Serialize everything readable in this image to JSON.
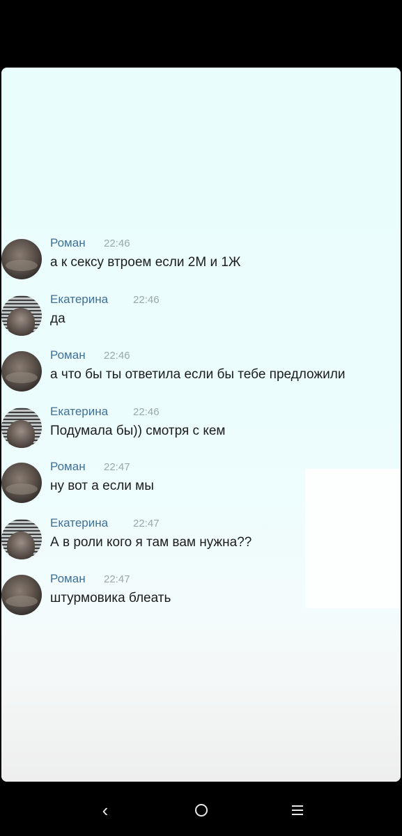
{
  "colors": {
    "name": "#3e6f95",
    "time": "#9aa7ad",
    "text": "#1c1c1c",
    "background": "#e9fdfd"
  },
  "messages": [
    {
      "sender": "Роман",
      "time": "22:46",
      "text": "а к сексу втроем если 2М и 1Ж",
      "avatar": "roman-avatar"
    },
    {
      "sender": "Екатерина",
      "time": "22:46",
      "text": "да",
      "avatar": "ekaterina-avatar"
    },
    {
      "sender": "Роман",
      "time": "22:46",
      "text": "а что бы ты ответила если бы тебе предложили",
      "avatar": "roman-avatar"
    },
    {
      "sender": "Екатерина",
      "time": "22:46",
      "text": "Подумала бы)) смотря с кем",
      "avatar": "ekaterina-avatar"
    },
    {
      "sender": "Роман",
      "time": "22:47",
      "text": "ну вот а если мы",
      "avatar": "roman-avatar"
    },
    {
      "sender": "Екатерина",
      "time": "22:47",
      "text": "А в роли кого я там вам нужна??",
      "avatar": "ekaterina-avatar"
    },
    {
      "sender": "Роман",
      "time": "22:47",
      "text": "штурмовика блеать",
      "avatar": "roman-avatar"
    }
  ],
  "navbar": {
    "back_icon": "back-chevron-icon",
    "home_icon": "home-circle-icon",
    "menu_icon": "menu-lines-icon",
    "back_glyph": "‹"
  }
}
